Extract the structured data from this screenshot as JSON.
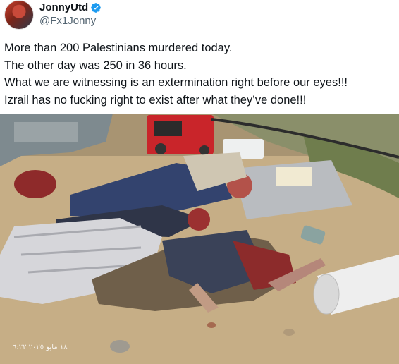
{
  "author": {
    "display_name": "JonnyUtd",
    "handle": "@Fx1Jonny",
    "verified": true,
    "icons": {
      "verified": "verified-badge-icon",
      "avatar": "avatar-image"
    },
    "colors": {
      "verified_badge": "#1d9bf0"
    }
  },
  "tweet": {
    "lines": [
      "More than 200 Palestinians murdered today.",
      "The other day was 250 in 36 hours.",
      "What we are witnessing is an extermination right before our eyes!!!",
      "Izrail has no fucking right to exist after what they’ve done!!!"
    ]
  },
  "media": {
    "watermark": "١٨ مايو ٢٠٢٥ ٦:٢٢"
  }
}
